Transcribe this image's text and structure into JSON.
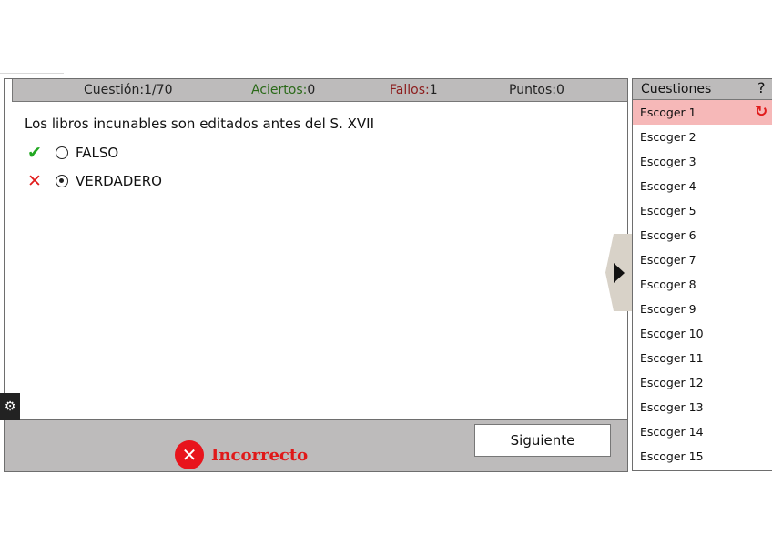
{
  "header": {
    "question_label": "Cuestión:",
    "question_value": "1/70",
    "hits_label": "Aciertos:",
    "hits_value": "0",
    "fails_label": "Fallos:",
    "fails_value": "1",
    "points_label": "Puntos:",
    "points_value": "0"
  },
  "question": {
    "text": "Los libros incunables son editados antes del S. XVII",
    "options": [
      {
        "label": "FALSO",
        "mark": "✔",
        "mark_icon": "check-icon",
        "selected": false
      },
      {
        "label": "VERDADERO",
        "mark": "✕",
        "mark_icon": "cross-icon",
        "selected": true
      }
    ]
  },
  "footer": {
    "result_text": "Incorrecto",
    "result_glyph": "✕",
    "next_label": "Siguiente",
    "gear_glyph": "⚙"
  },
  "sidebar": {
    "title": "Cuestiones",
    "help_label": "?",
    "retry_glyph": "↻",
    "items": [
      {
        "label": "Escoger 1"
      },
      {
        "label": "Escoger 2"
      },
      {
        "label": "Escoger 3"
      },
      {
        "label": "Escoger 4"
      },
      {
        "label": "Escoger 5"
      },
      {
        "label": "Escoger 6"
      },
      {
        "label": "Escoger 7"
      },
      {
        "label": "Escoger 8"
      },
      {
        "label": "Escoger 9"
      },
      {
        "label": "Escoger 10"
      },
      {
        "label": "Escoger 11"
      },
      {
        "label": "Escoger 12"
      },
      {
        "label": "Escoger 13"
      },
      {
        "label": "Escoger 14"
      },
      {
        "label": "Escoger 15"
      }
    ]
  },
  "colors": {
    "panel_gray": "#bdbbbb",
    "correct_green": "#22a822",
    "incorrect_red": "#e01919",
    "active_item": "#f6b8b8"
  }
}
